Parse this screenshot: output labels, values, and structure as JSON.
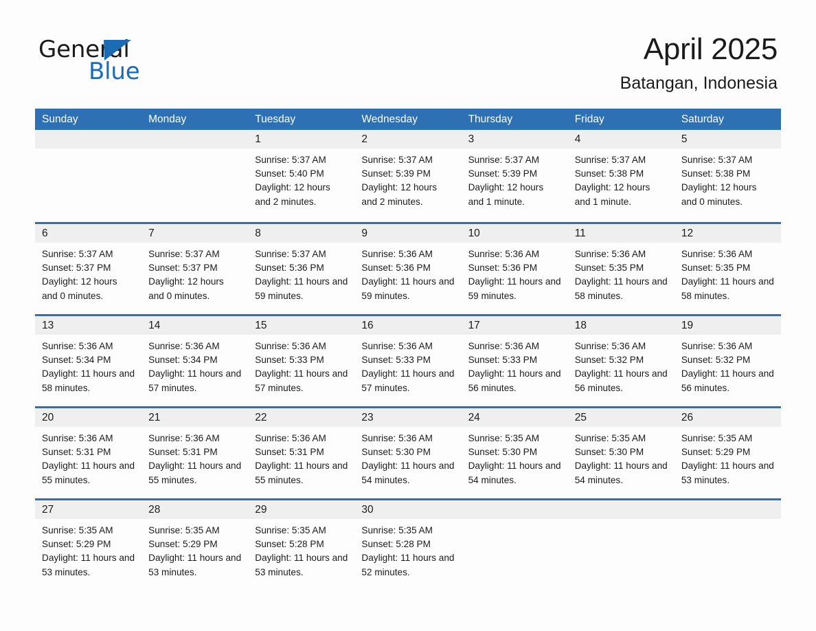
{
  "brand": {
    "word_one": "General",
    "word_two": "Blue",
    "accent_color": "#1b6cb5",
    "triangle_color": "#1b6cb5"
  },
  "header": {
    "title": "April 2025",
    "subtitle": "Batangan, Indonesia"
  },
  "theme": {
    "header_blue": "#2d70b3",
    "row_divider_blue": "#2d70b3",
    "daynum_strip_gray": "#efefef",
    "page_background": "#fdfdfd",
    "text_color": "#1b1b1b"
  },
  "weekdays": [
    "Sunday",
    "Monday",
    "Tuesday",
    "Wednesday",
    "Thursday",
    "Friday",
    "Saturday"
  ],
  "weeks": [
    [
      {
        "blank": true
      },
      {
        "blank": true
      },
      {
        "day": "1",
        "sunrise": "Sunrise: 5:37 AM",
        "sunset": "Sunset: 5:40 PM",
        "daylight": "Daylight: 12 hours and 2 minutes."
      },
      {
        "day": "2",
        "sunrise": "Sunrise: 5:37 AM",
        "sunset": "Sunset: 5:39 PM",
        "daylight": "Daylight: 12 hours and 2 minutes."
      },
      {
        "day": "3",
        "sunrise": "Sunrise: 5:37 AM",
        "sunset": "Sunset: 5:39 PM",
        "daylight": "Daylight: 12 hours and 1 minute."
      },
      {
        "day": "4",
        "sunrise": "Sunrise: 5:37 AM",
        "sunset": "Sunset: 5:38 PM",
        "daylight": "Daylight: 12 hours and 1 minute."
      },
      {
        "day": "5",
        "sunrise": "Sunrise: 5:37 AM",
        "sunset": "Sunset: 5:38 PM",
        "daylight": "Daylight: 12 hours and 0 minutes."
      }
    ],
    [
      {
        "day": "6",
        "sunrise": "Sunrise: 5:37 AM",
        "sunset": "Sunset: 5:37 PM",
        "daylight": "Daylight: 12 hours and 0 minutes."
      },
      {
        "day": "7",
        "sunrise": "Sunrise: 5:37 AM",
        "sunset": "Sunset: 5:37 PM",
        "daylight": "Daylight: 12 hours and 0 minutes."
      },
      {
        "day": "8",
        "sunrise": "Sunrise: 5:37 AM",
        "sunset": "Sunset: 5:36 PM",
        "daylight": "Daylight: 11 hours and 59 minutes."
      },
      {
        "day": "9",
        "sunrise": "Sunrise: 5:36 AM",
        "sunset": "Sunset: 5:36 PM",
        "daylight": "Daylight: 11 hours and 59 minutes."
      },
      {
        "day": "10",
        "sunrise": "Sunrise: 5:36 AM",
        "sunset": "Sunset: 5:36 PM",
        "daylight": "Daylight: 11 hours and 59 minutes."
      },
      {
        "day": "11",
        "sunrise": "Sunrise: 5:36 AM",
        "sunset": "Sunset: 5:35 PM",
        "daylight": "Daylight: 11 hours and 58 minutes."
      },
      {
        "day": "12",
        "sunrise": "Sunrise: 5:36 AM",
        "sunset": "Sunset: 5:35 PM",
        "daylight": "Daylight: 11 hours and 58 minutes."
      }
    ],
    [
      {
        "day": "13",
        "sunrise": "Sunrise: 5:36 AM",
        "sunset": "Sunset: 5:34 PM",
        "daylight": "Daylight: 11 hours and 58 minutes."
      },
      {
        "day": "14",
        "sunrise": "Sunrise: 5:36 AM",
        "sunset": "Sunset: 5:34 PM",
        "daylight": "Daylight: 11 hours and 57 minutes."
      },
      {
        "day": "15",
        "sunrise": "Sunrise: 5:36 AM",
        "sunset": "Sunset: 5:33 PM",
        "daylight": "Daylight: 11 hours and 57 minutes."
      },
      {
        "day": "16",
        "sunrise": "Sunrise: 5:36 AM",
        "sunset": "Sunset: 5:33 PM",
        "daylight": "Daylight: 11 hours and 57 minutes."
      },
      {
        "day": "17",
        "sunrise": "Sunrise: 5:36 AM",
        "sunset": "Sunset: 5:33 PM",
        "daylight": "Daylight: 11 hours and 56 minutes."
      },
      {
        "day": "18",
        "sunrise": "Sunrise: 5:36 AM",
        "sunset": "Sunset: 5:32 PM",
        "daylight": "Daylight: 11 hours and 56 minutes."
      },
      {
        "day": "19",
        "sunrise": "Sunrise: 5:36 AM",
        "sunset": "Sunset: 5:32 PM",
        "daylight": "Daylight: 11 hours and 56 minutes."
      }
    ],
    [
      {
        "day": "20",
        "sunrise": "Sunrise: 5:36 AM",
        "sunset": "Sunset: 5:31 PM",
        "daylight": "Daylight: 11 hours and 55 minutes."
      },
      {
        "day": "21",
        "sunrise": "Sunrise: 5:36 AM",
        "sunset": "Sunset: 5:31 PM",
        "daylight": "Daylight: 11 hours and 55 minutes."
      },
      {
        "day": "22",
        "sunrise": "Sunrise: 5:36 AM",
        "sunset": "Sunset: 5:31 PM",
        "daylight": "Daylight: 11 hours and 55 minutes."
      },
      {
        "day": "23",
        "sunrise": "Sunrise: 5:36 AM",
        "sunset": "Sunset: 5:30 PM",
        "daylight": "Daylight: 11 hours and 54 minutes."
      },
      {
        "day": "24",
        "sunrise": "Sunrise: 5:35 AM",
        "sunset": "Sunset: 5:30 PM",
        "daylight": "Daylight: 11 hours and 54 minutes."
      },
      {
        "day": "25",
        "sunrise": "Sunrise: 5:35 AM",
        "sunset": "Sunset: 5:30 PM",
        "daylight": "Daylight: 11 hours and 54 minutes."
      },
      {
        "day": "26",
        "sunrise": "Sunrise: 5:35 AM",
        "sunset": "Sunset: 5:29 PM",
        "daylight": "Daylight: 11 hours and 53 minutes."
      }
    ],
    [
      {
        "day": "27",
        "sunrise": "Sunrise: 5:35 AM",
        "sunset": "Sunset: 5:29 PM",
        "daylight": "Daylight: 11 hours and 53 minutes."
      },
      {
        "day": "28",
        "sunrise": "Sunrise: 5:35 AM",
        "sunset": "Sunset: 5:29 PM",
        "daylight": "Daylight: 11 hours and 53 minutes."
      },
      {
        "day": "29",
        "sunrise": "Sunrise: 5:35 AM",
        "sunset": "Sunset: 5:28 PM",
        "daylight": "Daylight: 11 hours and 53 minutes."
      },
      {
        "day": "30",
        "sunrise": "Sunrise: 5:35 AM",
        "sunset": "Sunset: 5:28 PM",
        "daylight": "Daylight: 11 hours and 52 minutes."
      },
      {
        "blank": true
      },
      {
        "blank": true
      },
      {
        "blank": true
      }
    ]
  ]
}
